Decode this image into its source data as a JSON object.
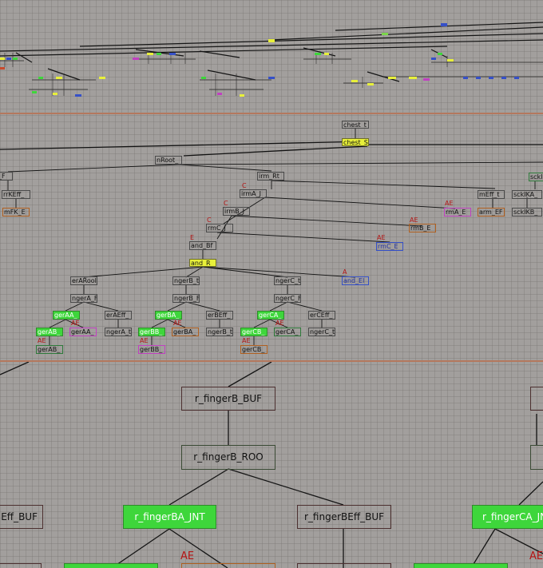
{
  "mid_nodes": [
    {
      "label": "chest_t",
      "style": "plain"
    },
    {
      "label": "chest_S",
      "style": "sel"
    },
    {
      "label": "nRoot_",
      "style": "plain"
    },
    {
      "label": "_F",
      "style": "plain"
    },
    {
      "label": "rrKEff_",
      "style": "plain"
    },
    {
      "label": "mFK_E",
      "style": "bbr"
    },
    {
      "label": "irm_Rt",
      "style": "plain"
    },
    {
      "label": "irmA_J",
      "style": "plain"
    },
    {
      "label": "irmB_J",
      "style": "plain"
    },
    {
      "label": "rmC_J",
      "style": "plain"
    },
    {
      "label": "and_Bf",
      "style": "plain"
    },
    {
      "label": "and_R",
      "style": "sel"
    },
    {
      "label": "rmA_E",
      "style": "bp"
    },
    {
      "label": "rmB_E",
      "style": "bbr"
    },
    {
      "label": "rmC_E",
      "style": "bb"
    },
    {
      "label": "and_El",
      "style": "bb"
    },
    {
      "label": "mEff_t",
      "style": "plain"
    },
    {
      "label": "arm_EF",
      "style": "bbr"
    },
    {
      "label": "sckIKA_",
      "style": "plain"
    },
    {
      "label": "sckIKB_",
      "style": "plain"
    },
    {
      "label": "sckIK",
      "style": "bg"
    },
    {
      "label": "erARool",
      "style": "plain"
    },
    {
      "label": "ngerA_F",
      "style": "plain"
    },
    {
      "label": "gerAA_",
      "style": "jnt"
    },
    {
      "label": "erAEff_",
      "style": "plain"
    },
    {
      "label": "gerAB_",
      "style": "jnt"
    },
    {
      "label": "gerAA_",
      "style": "bp"
    },
    {
      "label": "ngerA_t",
      "style": "plain"
    },
    {
      "label": "gerAB_",
      "style": "bg"
    },
    {
      "label": "ngerB_t",
      "style": "plain"
    },
    {
      "label": "ngerB_F",
      "style": "plain"
    },
    {
      "label": "gerBA_",
      "style": "jnt"
    },
    {
      "label": "erBEff_",
      "style": "plain"
    },
    {
      "label": "gerBB_",
      "style": "jnt"
    },
    {
      "label": "gerBA_",
      "style": "bbr"
    },
    {
      "label": "ngerB_t",
      "style": "plain"
    },
    {
      "label": "gerBB_",
      "style": "bp"
    },
    {
      "label": "ngerC_t",
      "style": "plain"
    },
    {
      "label": "ngerC_F",
      "style": "plain"
    },
    {
      "label": "gerCA_",
      "style": "jnt"
    },
    {
      "label": "erCEff_",
      "style": "plain"
    },
    {
      "label": "gerCB_",
      "style": "jnt"
    },
    {
      "label": "gerCA_",
      "style": "bg"
    },
    {
      "label": "ngerC_t",
      "style": "plain"
    },
    {
      "label": "gerCB_",
      "style": "bbr"
    }
  ],
  "mid_tags": [
    "C",
    "C",
    "C",
    "E",
    "AE",
    "AE",
    "AE",
    "A",
    "AE",
    "AE",
    "AE",
    "AE",
    "AE",
    "AE"
  ],
  "bottom_nodes": [
    {
      "label": "r_fingerB_BUF",
      "style": "sml"
    },
    {
      "label": "r_fingerB_ROO",
      "style": "smg"
    },
    {
      "label": "Eff_BUF",
      "style": "sml"
    },
    {
      "label": "r_fingerBA_JNT",
      "style": "jnt"
    },
    {
      "label": "r_fingerBEff_BUF",
      "style": "sml"
    },
    {
      "label": "r_fingerCA_JN",
      "style": "jnt"
    }
  ],
  "bottom_tags": [
    "AE",
    "AE"
  ],
  "colors": {
    "background": "#a29f9d",
    "divider": "#b4785e",
    "selected": "#e8f03a",
    "joint": "#3ed63b",
    "annotation": "#b41414"
  }
}
